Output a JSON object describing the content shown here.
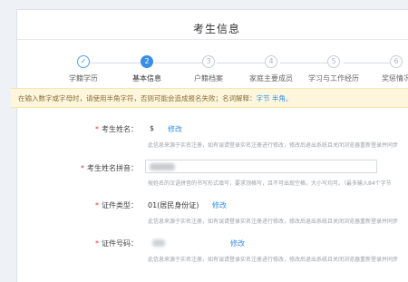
{
  "header": {
    "title": "考生信息"
  },
  "steps": [
    {
      "num": "✓",
      "label": "学籍学历",
      "state": "done"
    },
    {
      "num": "2",
      "label": "基本信息",
      "state": "active"
    },
    {
      "num": "3",
      "label": "户籍档案",
      "state": "todo"
    },
    {
      "num": "4",
      "label": "家庭主要成员",
      "state": "todo"
    },
    {
      "num": "5",
      "label": "学习与工作经历",
      "state": "todo"
    },
    {
      "num": "6",
      "label": "奖惩情况",
      "state": "todo"
    }
  ],
  "notice": {
    "text": "在输入数字或字母时，请使用半角字符，否则可能会造成报名失败；名词解释：",
    "link": "字节 半角。"
  },
  "form": {
    "name": {
      "label": "考生姓名：",
      "value": "$",
      "edit": "修改",
      "hint": "此信息来源于实名注册，如有误请登录实名注册进行修改，修改后退出系统且关闭浏览器重新登录并同步"
    },
    "pinyin": {
      "label": "考生姓名拼音：",
      "hint": "按姓名的汉语拼音的书写形式填写，要求顶格写，且不可出现空格，大小写均可。（最多输入84个字节"
    },
    "id_type": {
      "label": "证件类型：",
      "value": "01(居民身份证)",
      "edit": "修改",
      "hint": "此信息来源于实名注册，如有误请登录实名注册进行修改，修改后退出系统且关闭浏览器重新登录并同步"
    },
    "id_num": {
      "label": "证件号码：",
      "edit": "修改",
      "hint": "此信息来源于实名注册，如有误请登录实名注册进行修改，修改后退出系统且关闭浏览器重新登录并同步"
    }
  }
}
